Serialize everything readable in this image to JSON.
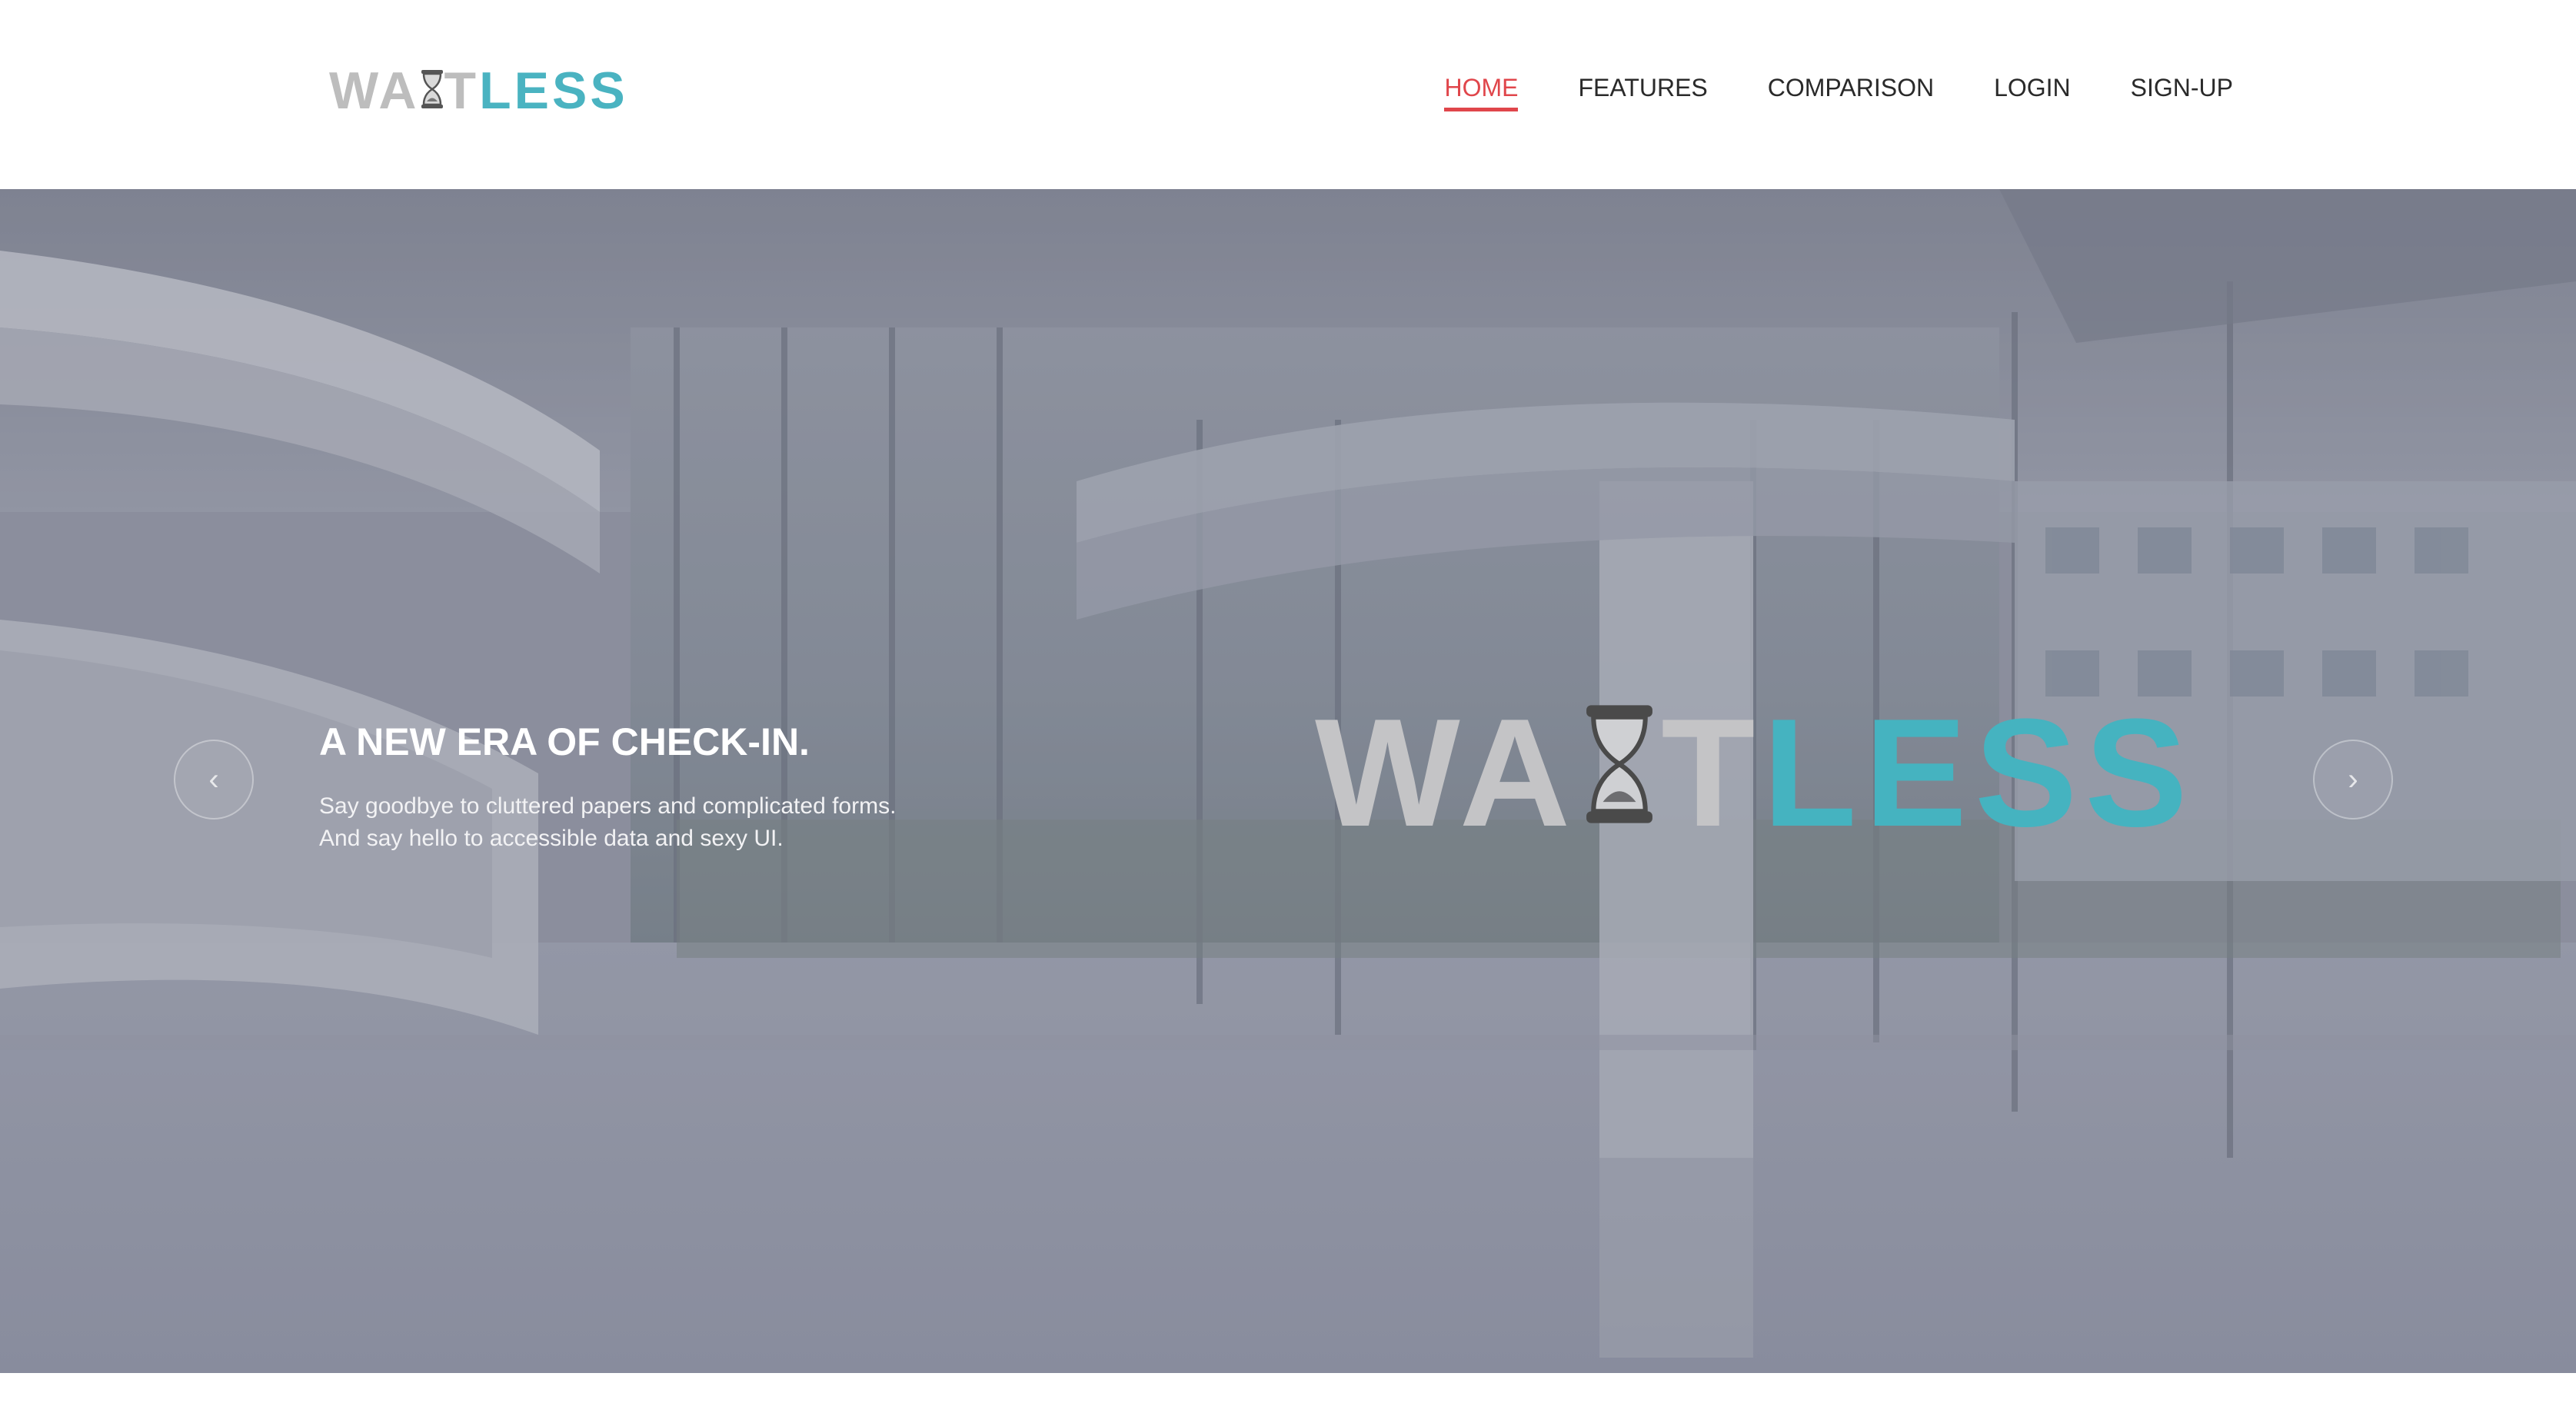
{
  "brand": {
    "logo_part1": "WA",
    "logo_part2": "T",
    "logo_part3": "LESS",
    "hourglass_icon": "hourglass-icon",
    "gray_color": "#bdbdbd",
    "teal_color": "#4ab3c1"
  },
  "nav": {
    "items": [
      {
        "label": "HOME",
        "active": true
      },
      {
        "label": "FEATURES",
        "active": false
      },
      {
        "label": "COMPARISON",
        "active": false
      },
      {
        "label": "LOGIN",
        "active": false
      },
      {
        "label": "SIGN-UP",
        "active": false
      }
    ],
    "active_color": "#e0464b"
  },
  "hero": {
    "heading": "A NEW ERA OF CHECK-IN.",
    "line1": "Say goodbye to cluttered papers and complicated forms.",
    "line2": "And say hello to accessible data and sexy UI.",
    "logo_part1": "WA",
    "logo_part2": "T",
    "logo_part3": "LESS",
    "prev_icon": "chevron-left-icon",
    "next_icon": "chevron-right-icon",
    "prev_glyph": "‹",
    "next_glyph": "›"
  }
}
